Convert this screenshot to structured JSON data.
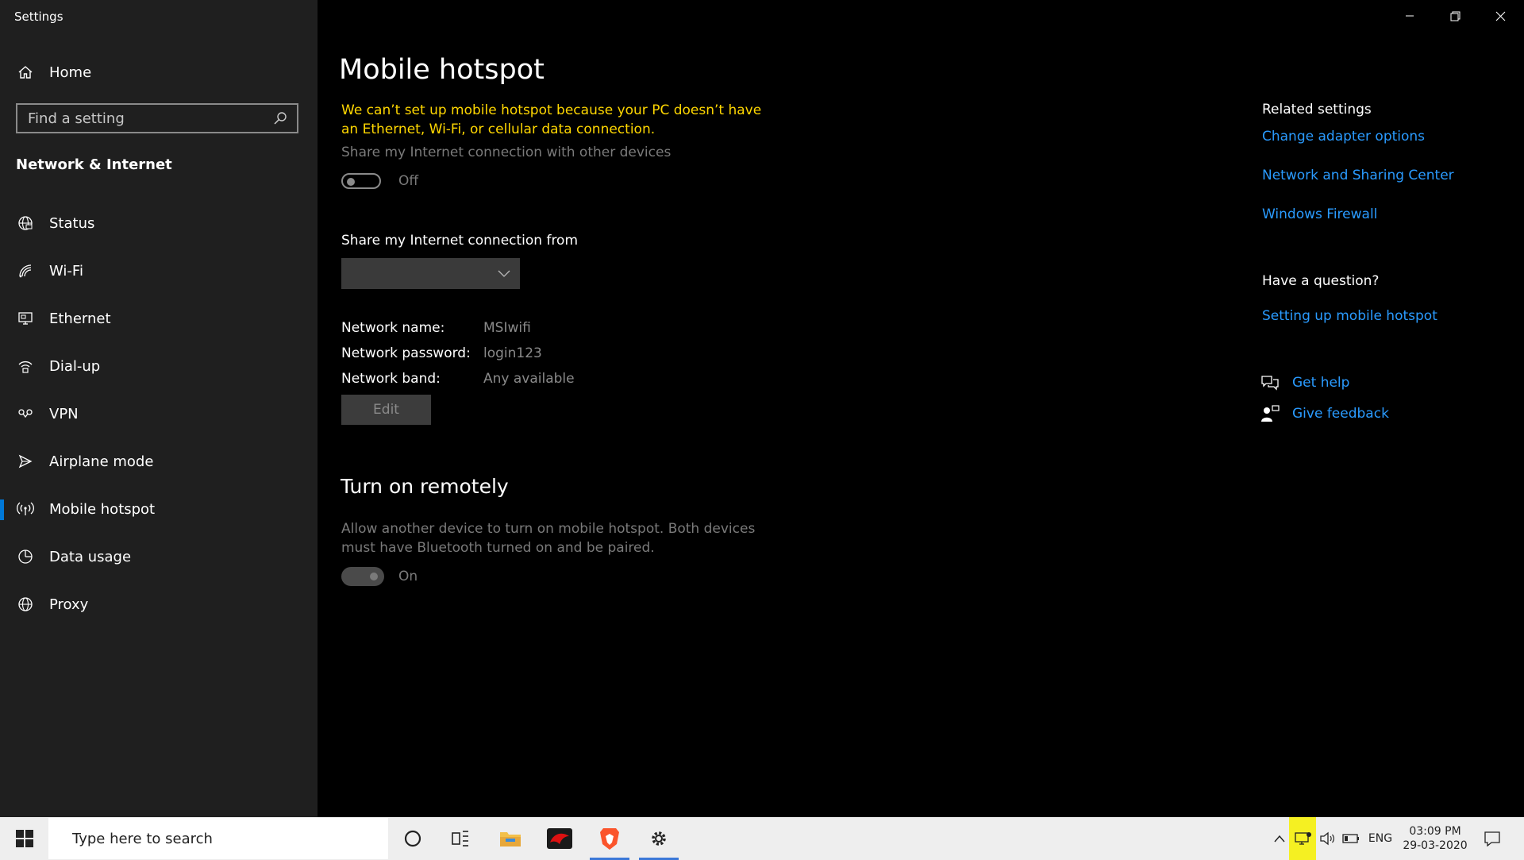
{
  "app": {
    "title": "Settings"
  },
  "sidebar": {
    "home_label": "Home",
    "search_placeholder": "Find a setting",
    "section_heading": "Network & Internet",
    "items": [
      {
        "label": "Status",
        "icon": "globe-status-icon"
      },
      {
        "label": "Wi-Fi",
        "icon": "wifi-icon"
      },
      {
        "label": "Ethernet",
        "icon": "ethernet-icon"
      },
      {
        "label": "Dial-up",
        "icon": "dialup-icon"
      },
      {
        "label": "VPN",
        "icon": "vpn-icon"
      },
      {
        "label": "Airplane mode",
        "icon": "airplane-icon"
      },
      {
        "label": "Mobile hotspot",
        "icon": "hotspot-icon",
        "active": true
      },
      {
        "label": "Data usage",
        "icon": "data-usage-icon"
      },
      {
        "label": "Proxy",
        "icon": "globe-icon"
      }
    ]
  },
  "main": {
    "title": "Mobile hotspot",
    "warning": "We can’t set up mobile hotspot because your PC doesn’t have an Ethernet, Wi-Fi, or cellular data connection.",
    "share_label": "Share my Internet connection with other devices",
    "share_toggle_state": "Off",
    "share_from_label": "Share my Internet connection from",
    "share_from_value": "",
    "network": {
      "name_label": "Network name:",
      "name_value": "MSIwifi",
      "password_label": "Network password:",
      "password_value": "login123",
      "band_label": "Network band:",
      "band_value": "Any available"
    },
    "edit_label": "Edit",
    "remote_heading": "Turn on remotely",
    "remote_desc": "Allow another device to turn on mobile hotspot. Both devices must have Bluetooth turned on and be paired.",
    "remote_toggle_state": "On"
  },
  "related": {
    "heading": "Related settings",
    "links": [
      "Change adapter options",
      "Network and Sharing Center",
      "Windows Firewall"
    ],
    "question_heading": "Have a question?",
    "question_link": "Setting up mobile hotspot",
    "get_help": "Get help",
    "give_feedback": "Give feedback"
  },
  "taskbar": {
    "search_placeholder": "Type here to search",
    "language": "ENG",
    "time": "03:09 PM",
    "date": "29-03-2020",
    "accent_color": "#0078d7",
    "link_color": "#2a9bff",
    "warning_color": "#ffd700"
  }
}
